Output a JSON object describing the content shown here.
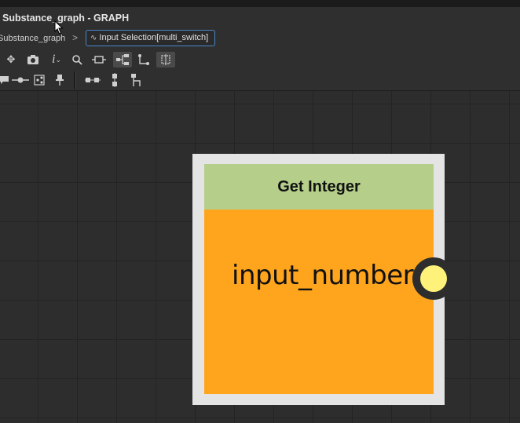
{
  "window": {
    "title": "Substance_graph - GRAPH"
  },
  "breadcrumb": {
    "root": "Substance_graph",
    "separator": ">",
    "current_icon": "∿",
    "current": "Input Selection[multi_switch]"
  },
  "toolbar_row1": [
    {
      "icon": "move-view-icon",
      "glyph": "✥",
      "active": false
    },
    {
      "icon": "camera-icon",
      "glyph": "📷",
      "active": false
    },
    {
      "icon": "info-icon",
      "glyph": "i",
      "active": false
    },
    {
      "icon": "search-icon",
      "glyph": "⌕",
      "active": false
    },
    {
      "icon": "frame-selection-icon",
      "glyph": "⊡",
      "active": false
    },
    {
      "icon": "layout-tree-icon",
      "glyph": "⋲",
      "active": true
    },
    {
      "icon": "link-style-icon",
      "glyph": "⌐",
      "active": false
    },
    {
      "icon": "grid-snap-icon",
      "glyph": "⊞",
      "active": true
    }
  ],
  "toolbar_row2": [
    {
      "icon": "comment-icon",
      "glyph": "▬"
    },
    {
      "icon": "connector-icon",
      "glyph": "-●-"
    },
    {
      "icon": "graph-node-icon",
      "glyph": "⧉"
    },
    {
      "icon": "pin-icon",
      "glyph": "⍊"
    },
    {
      "icon": "align-horizontal-icon",
      "glyph": "⋯"
    },
    {
      "icon": "align-vertical-icon",
      "glyph": "⋮"
    },
    {
      "icon": "distribute-icon",
      "glyph": "⊓"
    }
  ],
  "node": {
    "title": "Get Integer",
    "output_label": "input_number",
    "colors": {
      "frame": "#e4e4e4",
      "header": "#b5cf8a",
      "body": "#ffa51d",
      "port": "#fff27a"
    }
  }
}
